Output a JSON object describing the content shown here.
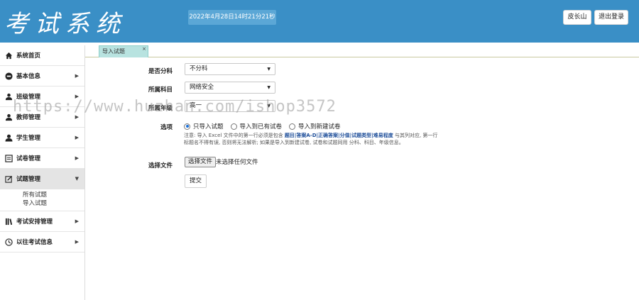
{
  "header": {
    "logo": "考试系统",
    "datetime": "2022年4月28日14时21分21秒",
    "user_button": "皮长山",
    "logout_button": "退出登录"
  },
  "sidebar": {
    "items": [
      {
        "label": "系统首页",
        "icon": "home-icon"
      },
      {
        "label": "基本信息",
        "icon": "info-icon"
      },
      {
        "label": "班级管理",
        "icon": "group-icon"
      },
      {
        "label": "教师管理",
        "icon": "teacher-icon"
      },
      {
        "label": "学生管理",
        "icon": "student-icon"
      },
      {
        "label": "试卷管理",
        "icon": "paper-icon"
      },
      {
        "label": "试题管理",
        "icon": "question-icon"
      },
      {
        "label": "考试安排管理",
        "icon": "schedule-icon"
      },
      {
        "label": "以往考试信息",
        "icon": "history-icon"
      }
    ],
    "sub_items": [
      "所有试题",
      "导入试题"
    ]
  },
  "tab": {
    "label": "导入试题",
    "close": "×"
  },
  "form": {
    "split_label": "是否分科",
    "split_value": "不分科",
    "subject_label": "所属科目",
    "subject_value": "网络安全",
    "grade_label": "所属年级",
    "grade_value": "高一",
    "options_label": "选项",
    "radio_options": [
      "只导入试题",
      "导入到已有试卷",
      "导入到新建试卷"
    ],
    "note_prefix": "注意: 导入 Excel 文件中的第一行必须是包含",
    "note_fields": "题目|答案A-D|正确答案|分值|试题类型|难易程度",
    "note_suffix": "与其列对应, 第一行标题名不得有误, 否则将无法解析; 如果是导入到新建试卷, 试卷和试题同用 分科、科目、年级信息。",
    "file_label": "选择文件",
    "file_button": "选择文件",
    "file_none": "未选择任何文件",
    "submit": "提交"
  },
  "watermark": "https://www.huzhan.com/ishop3572",
  "colors": {
    "header": "#3a8fc6",
    "tab": "#b8e3e0",
    "accent": "#1a6fd8"
  }
}
